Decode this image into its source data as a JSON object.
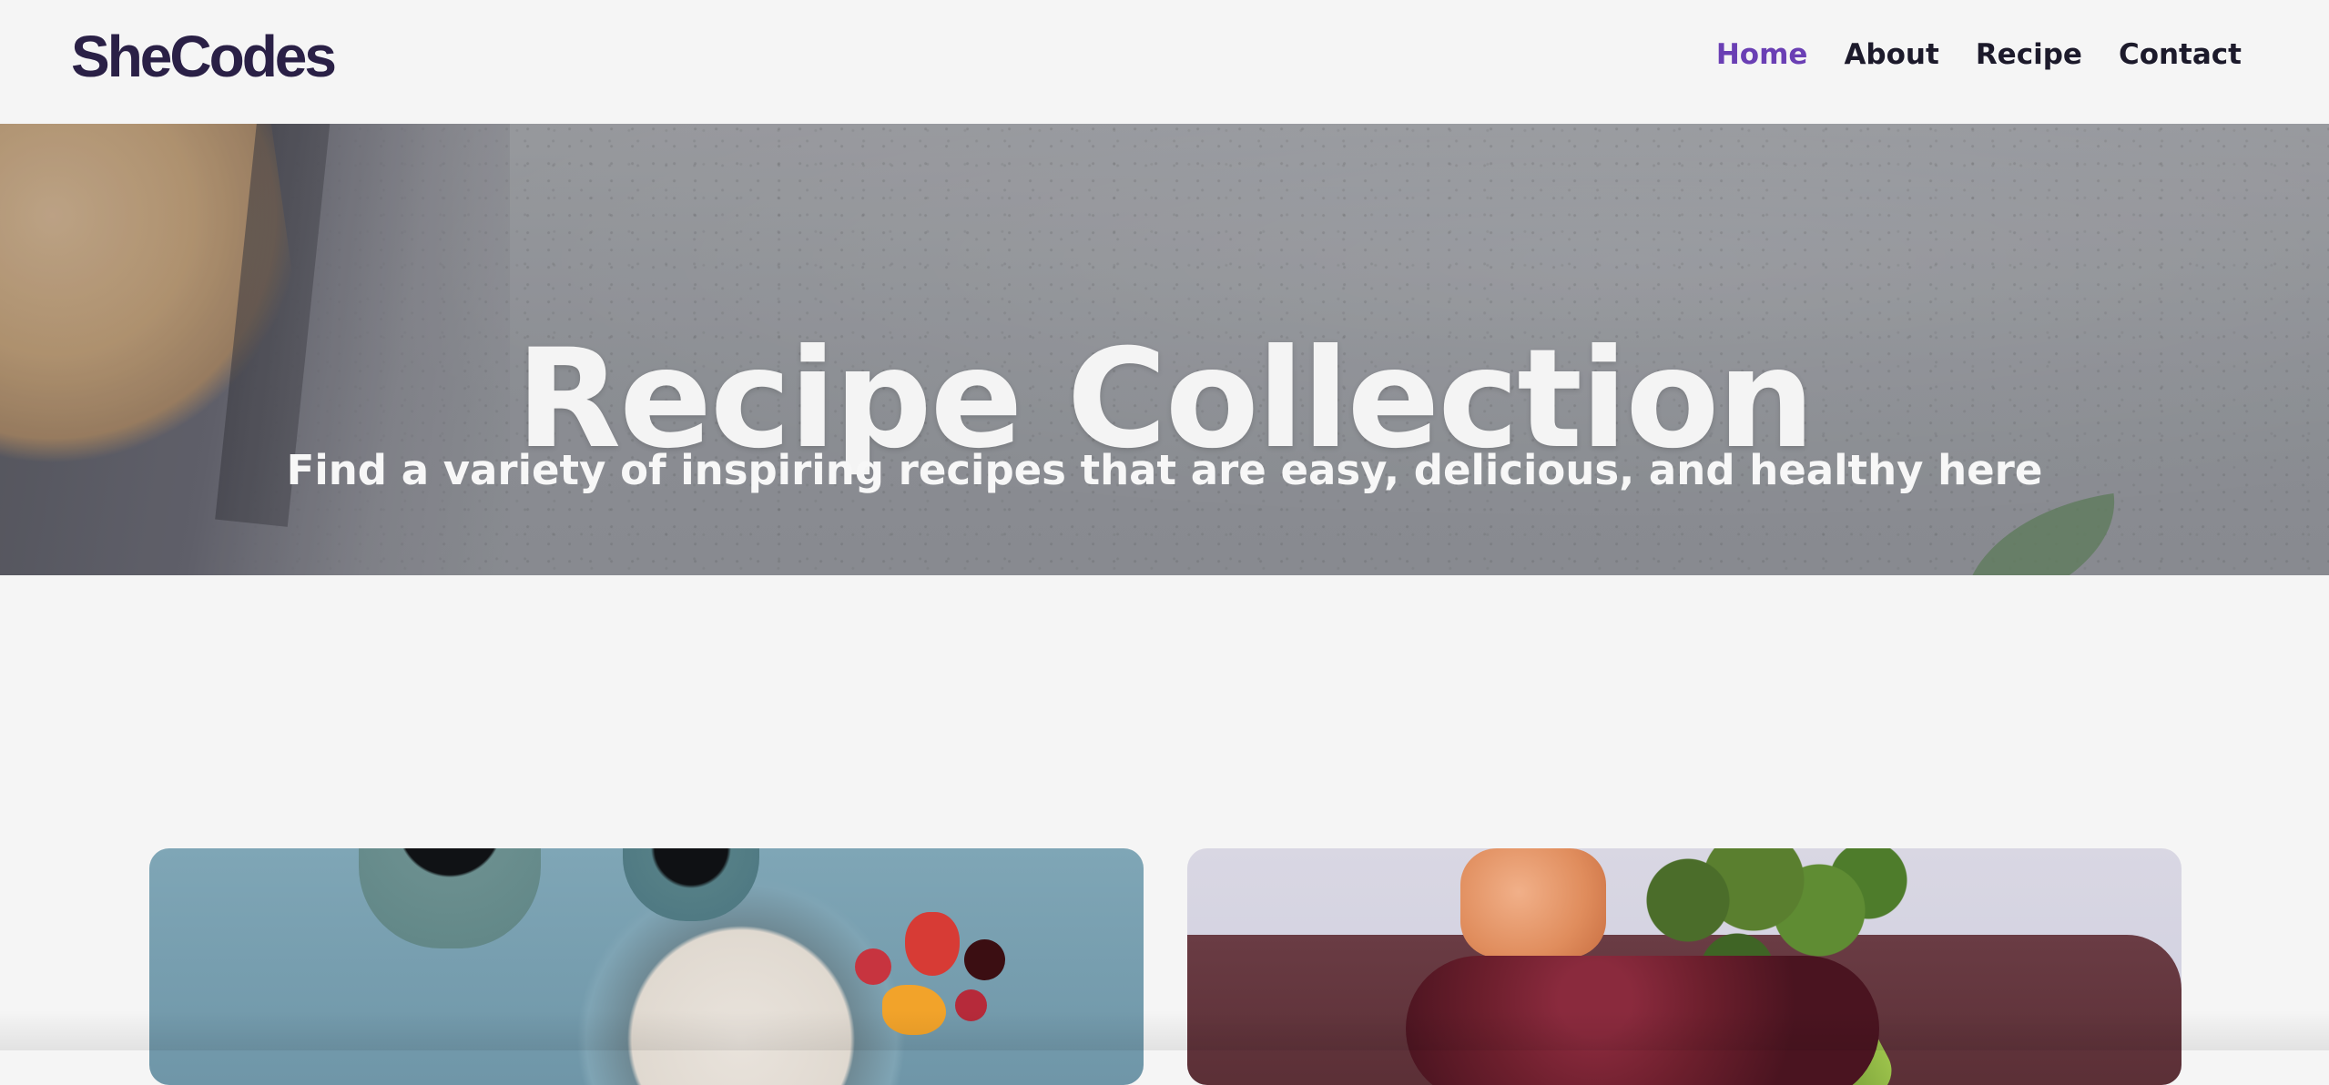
{
  "brand": {
    "logo_text": "SheCodes",
    "colors": {
      "logo": "#2a2046",
      "nav_text": "#1c1a2b",
      "nav_active": "#6a3fb4",
      "page_background": "#f5f5f5"
    }
  },
  "nav": {
    "items": [
      {
        "label": "Home",
        "active": true
      },
      {
        "label": "About",
        "active": false
      },
      {
        "label": "Recipe",
        "active": false
      },
      {
        "label": "Contact",
        "active": false
      }
    ]
  },
  "hero": {
    "title": "Recipe Collection",
    "subtitle": "Find a variety of inspiring recipes that are easy, delicious, and healthy here"
  },
  "cards": [
    {
      "image_label": "breakfast-bowl-image"
    },
    {
      "image_label": "grilled-meat-vegetables-image"
    }
  ]
}
